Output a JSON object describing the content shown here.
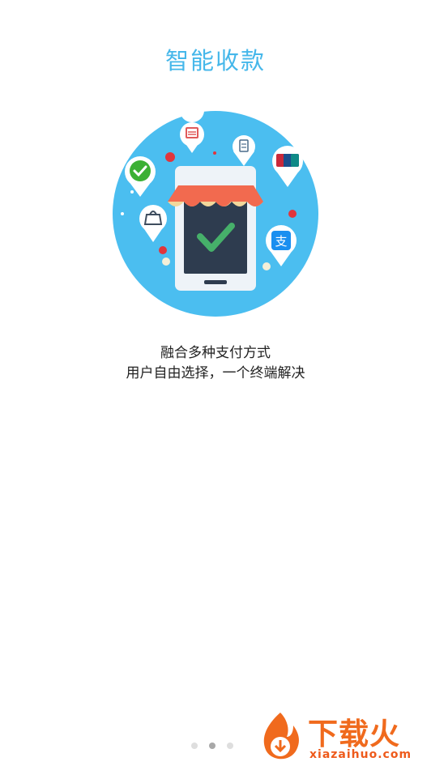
{
  "header": {
    "title": "智能收款"
  },
  "illustration": {
    "bg_color": "#4bbef0",
    "accent": "#46b06a"
  },
  "description": {
    "line1": "融合多种支付方式",
    "line2": "用户自由选择，一个终端解决"
  },
  "pager": {
    "count": 3,
    "active_index": 1
  },
  "watermark": {
    "brand": "下载火",
    "url": "xiazaihuo.com"
  }
}
